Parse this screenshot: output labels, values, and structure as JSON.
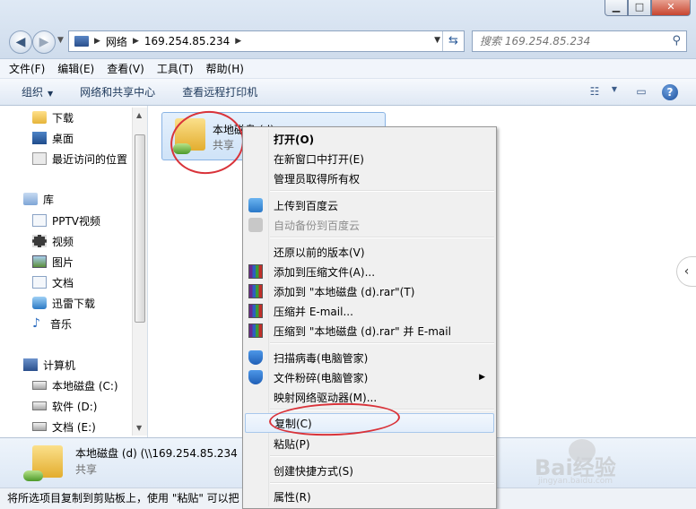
{
  "window": {
    "min_label": "▁",
    "max_label": "□",
    "close_label": "✕"
  },
  "address": {
    "root": "网络",
    "host": "169.254.85.234"
  },
  "search": {
    "placeholder": "搜索 169.254.85.234"
  },
  "menubar": [
    "文件(F)",
    "编辑(E)",
    "查看(V)",
    "工具(T)",
    "帮助(H)"
  ],
  "toolbar": {
    "organize": "组织",
    "network_center": "网络和共享中心",
    "remote_printers": "查看远程打印机"
  },
  "sidebar": {
    "favorites": [
      "下载",
      "桌面",
      "最近访问的位置"
    ],
    "library_title": "库",
    "libraries": [
      "PPTV视频",
      "视频",
      "图片",
      "文档",
      "迅雷下载",
      "音乐"
    ],
    "computer_title": "计算机",
    "drives": [
      "本地磁盘 (C:)",
      "软件 (D:)",
      "文档 (E:)"
    ]
  },
  "item": {
    "name": "本地磁盘 (d)",
    "sub": "共享"
  },
  "details": {
    "name": "本地磁盘 (d) (\\\\169.254.85.234",
    "sub": "共享"
  },
  "status": "将所选项目复制到剪贴板上，使用 \"粘贴\" 可以把",
  "context_menu": {
    "open": "打开(O)",
    "open_new": "在新窗口中打开(E)",
    "admin": "管理员取得所有权",
    "upload_baidu": "上传到百度云",
    "auto_backup": "自动备份到百度云",
    "restore": "还原以前的版本(V)",
    "add_archive": "添加到压缩文件(A)...",
    "add_rar": "添加到 \"本地磁盘 (d).rar\"(T)",
    "compress_email": "压缩并 E-mail...",
    "compress_rar_email": "压缩到 \"本地磁盘 (d).rar\" 并 E-mail",
    "scan": "扫描病毒(电脑管家)",
    "shred": "文件粉碎(电脑管家)",
    "map_drive": "映射网络驱动器(M)...",
    "copy": "复制(C)",
    "paste": "粘贴(P)",
    "shortcut": "创建快捷方式(S)",
    "properties": "属性(R)"
  },
  "watermark": {
    "brand": "Bai经验",
    "url": "jingyan.baidu.com"
  },
  "colors": {
    "annotation_red": "#d9333a",
    "highlight_border": "#a8c8ec"
  }
}
